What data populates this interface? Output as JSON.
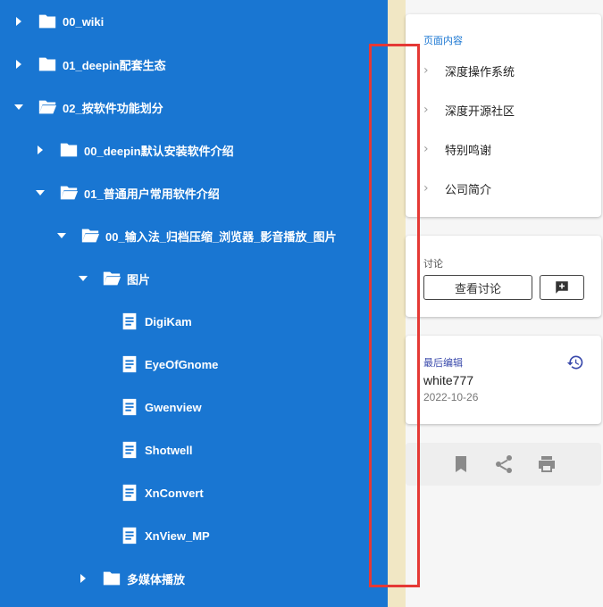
{
  "tree": {
    "items": [
      {
        "label": "00_wiki",
        "expanded": false,
        "type": "folder",
        "level": 0
      },
      {
        "label": "01_deepin配套生态",
        "expanded": false,
        "type": "folder",
        "level": 0
      },
      {
        "label": "02_按软件功能划分",
        "expanded": true,
        "type": "folder",
        "level": 0
      },
      {
        "label": "00_deepin默认安装软件介绍",
        "expanded": false,
        "type": "folder",
        "level": 1
      },
      {
        "label": "01_普通用户常用软件介绍",
        "expanded": true,
        "type": "folder",
        "level": 1
      },
      {
        "label": "00_输入法_归档压缩_浏览器_影音播放_图片",
        "expanded": true,
        "type": "folder",
        "level": 2
      },
      {
        "label": "图片",
        "expanded": true,
        "type": "folder",
        "level": 3
      },
      {
        "label": "DigiKam",
        "type": "page",
        "level": 4
      },
      {
        "label": "EyeOfGnome",
        "type": "page",
        "level": 4
      },
      {
        "label": "Gwenview",
        "type": "page",
        "level": 4
      },
      {
        "label": "Shotwell",
        "type": "page",
        "level": 4
      },
      {
        "label": "XnConvert",
        "type": "page",
        "level": 4
      },
      {
        "label": "XnView_MP",
        "type": "page",
        "level": 4
      },
      {
        "label": "多媒体播放",
        "expanded": false,
        "type": "folder",
        "level": 3
      }
    ]
  },
  "toc": {
    "title": "页面内容",
    "items": [
      "深度操作系统",
      "深度开源社区",
      "特别鸣谢",
      "公司简介"
    ]
  },
  "discussion": {
    "title": "讨论",
    "view_label": "查看讨论",
    "icon": "add-comment-icon"
  },
  "last_edit": {
    "title": "最后编辑",
    "user": "white777",
    "date": "2022-10-26",
    "icon": "history-icon"
  },
  "actions": [
    "bookmark-icon",
    "share-icon",
    "print-icon"
  ],
  "colors": {
    "tree_bg": "#1976d2",
    "strip": "#f1e7c4",
    "highlight": "#e53935",
    "toc_title": "#1976d2",
    "edit_title": "#3949ab"
  }
}
